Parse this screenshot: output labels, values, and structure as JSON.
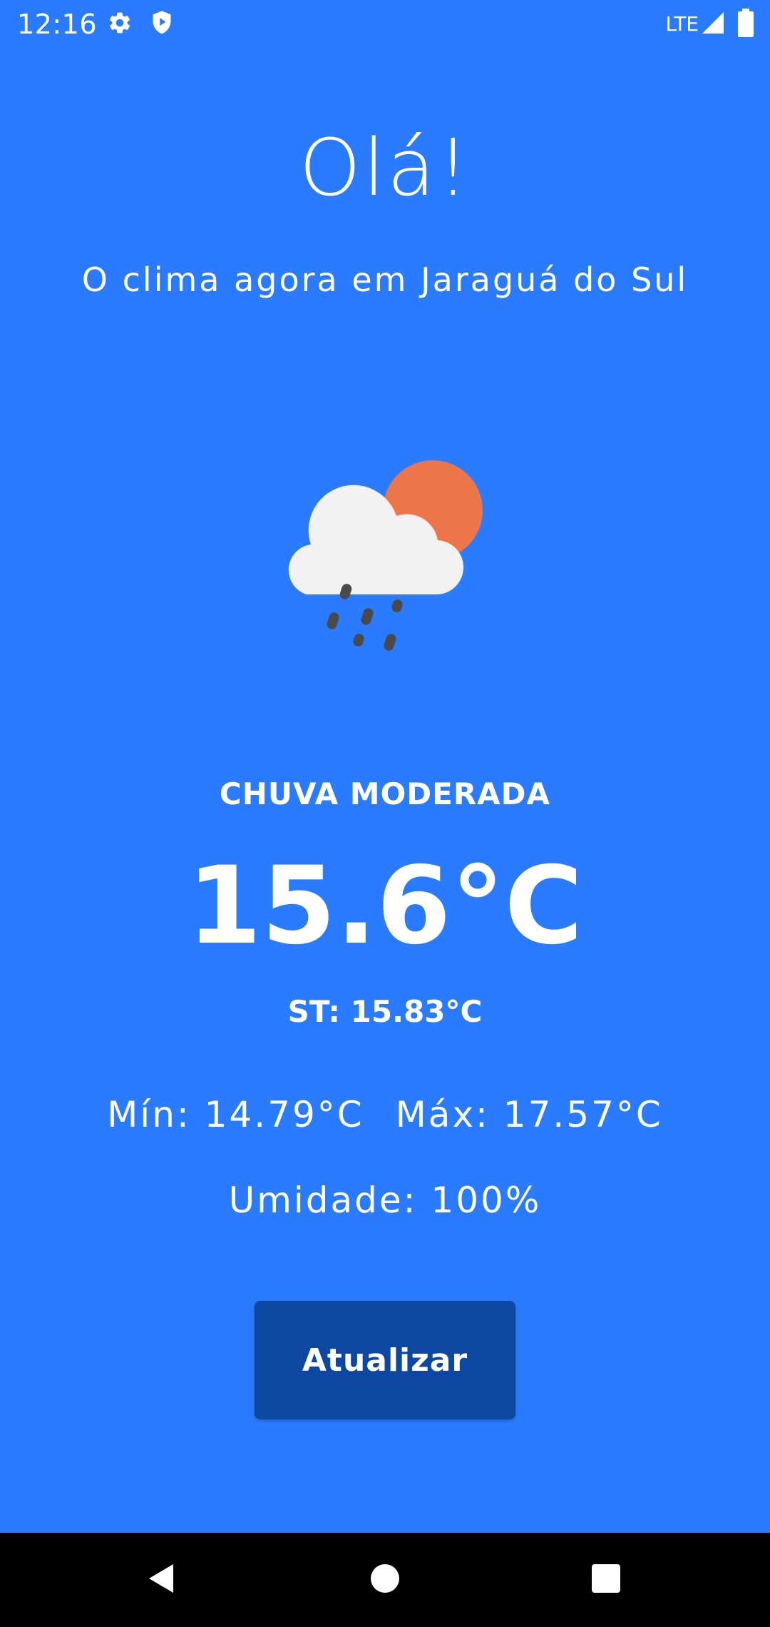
{
  "status_bar": {
    "time": "12:16",
    "network": "LTE",
    "icons": [
      "gear-icon",
      "play-protect-icon",
      "signal-icon",
      "battery-icon"
    ]
  },
  "main": {
    "greeting": "Olá!",
    "subtitle": "O clima agora em Jaraguá do Sul",
    "weather_icon": "cloud-rain-sun-icon",
    "condition": "CHUVA MODERADA",
    "temperature": "15.6°C",
    "feels_like": "ST: 15.83°C",
    "min": "Mín: 14.79°C",
    "max": "Máx: 17.57°C",
    "humidity": "Umidade: 100%",
    "refresh_label": "Atualizar"
  },
  "nav_bar": {
    "icons": [
      "back-icon",
      "home-icon",
      "recents-icon"
    ]
  },
  "colors": {
    "background": "#2a7bff",
    "button": "#0d47a1",
    "sun": "#ec754a",
    "cloud": "#f2f2f2",
    "rain": "#4a4a4a"
  }
}
